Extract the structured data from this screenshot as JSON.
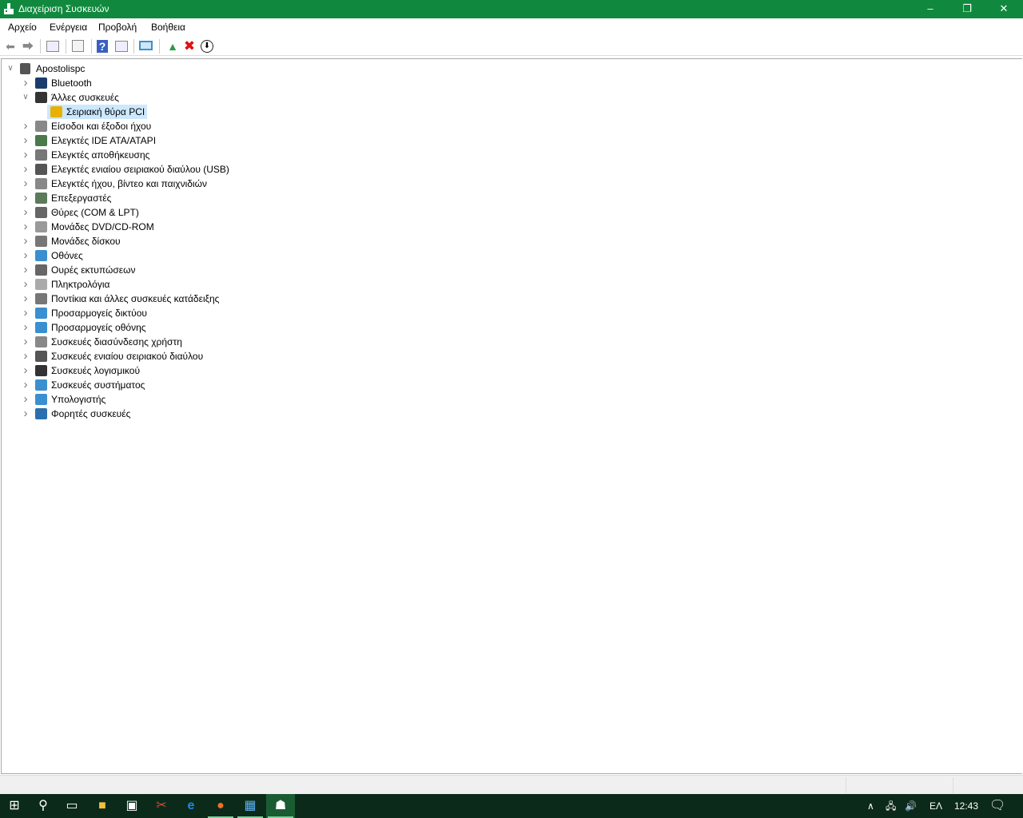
{
  "window": {
    "title": "Διαχείριση Συσκευών",
    "controls": [
      "minimize",
      "restore",
      "close"
    ]
  },
  "menu": [
    "Αρχείο",
    "Ενέργεια",
    "Προβολή",
    "Βοήθεια"
  ],
  "toolbar": [
    "back-icon",
    "forward-icon",
    "show-hide-console-tree-icon",
    "properties-icon",
    "help-icon",
    "action-pane-icon",
    "scan-hardware-icon",
    "update-driver-icon",
    "uninstall-icon",
    "disable-icon"
  ],
  "tree": {
    "root": "Apostolispc",
    "categories": [
      {
        "label": "Bluetooth",
        "icon": "bluetooth-icon",
        "color": "#1b3d6b"
      },
      {
        "label": "Άλλες συσκευές",
        "icon": "other-devices-icon",
        "color": "#333",
        "expanded": true,
        "children": [
          {
            "label": "Σειριακή θύρα PCI",
            "icon": "warning-device-icon"
          }
        ]
      },
      {
        "label": "Είσοδοι και έξοδοι ήχου",
        "icon": "speaker-icon",
        "color": "#888"
      },
      {
        "label": "Ελεγκτές IDE ATA/ATAPI",
        "icon": "ide-controller-icon",
        "color": "#4a7a4a"
      },
      {
        "label": "Ελεγκτές αποθήκευσης",
        "icon": "storage-controller-icon",
        "color": "#777"
      },
      {
        "label": "Ελεγκτές ενιαίου σειριακού διαύλου (USB)",
        "icon": "usb-icon",
        "color": "#555"
      },
      {
        "label": "Ελεγκτές ήχου, βίντεο και παιχνιδιών",
        "icon": "sound-icon",
        "color": "#888"
      },
      {
        "label": "Επεξεργαστές",
        "icon": "processor-icon",
        "color": "#5a7a5a"
      },
      {
        "label": "Θύρες (COM & LPT)",
        "icon": "port-icon",
        "color": "#666"
      },
      {
        "label": "Μονάδες DVD/CD-ROM",
        "icon": "dvd-icon",
        "color": "#999"
      },
      {
        "label": "Μονάδες δίσκου",
        "icon": "disk-icon",
        "color": "#777"
      },
      {
        "label": "Οθόνες",
        "icon": "monitor-icon",
        "color": "#3a8fd0"
      },
      {
        "label": "Ουρές εκτυπώσεων",
        "icon": "printer-icon",
        "color": "#666"
      },
      {
        "label": "Πληκτρολόγια",
        "icon": "keyboard-icon",
        "color": "#aaa"
      },
      {
        "label": "Ποντίκια και άλλες συσκευές κατάδειξης",
        "icon": "mouse-icon",
        "color": "#777"
      },
      {
        "label": "Προσαρμογείς δικτύου",
        "icon": "network-adapter-icon",
        "color": "#3a8fd0"
      },
      {
        "label": "Προσαρμογείς οθόνης",
        "icon": "display-adapter-icon",
        "color": "#3a8fd0"
      },
      {
        "label": "Συσκευές διασύνδεσης χρήστη",
        "icon": "hid-icon",
        "color": "#888"
      },
      {
        "label": "Συσκευές ενιαίου σειριακού διαύλου",
        "icon": "usb-device-icon",
        "color": "#555"
      },
      {
        "label": "Συσκευές λογισμικού",
        "icon": "software-device-icon",
        "color": "#333"
      },
      {
        "label": "Συσκευές συστήματος",
        "icon": "system-devices-icon",
        "color": "#3a8fd0"
      },
      {
        "label": "Υπολογιστής",
        "icon": "computer-icon",
        "color": "#3a8fd0"
      },
      {
        "label": "Φορητές συσκευές",
        "icon": "portable-device-icon",
        "color": "#2a6fb0"
      }
    ]
  },
  "taskbar": {
    "apps": [
      "start-icon",
      "search-icon",
      "task-view-icon",
      "file-explorer-icon",
      "store-icon",
      "snipping-tool-icon",
      "edge-icon",
      "firefox-icon",
      "control-panel-icon",
      "device-manager-icon"
    ],
    "tray": {
      "language": "ΕΛ",
      "time": "12:43"
    }
  },
  "colors": {
    "titlebar": "#10893e",
    "taskbar": "#0c2a1a",
    "selection": "#cce8ff"
  }
}
